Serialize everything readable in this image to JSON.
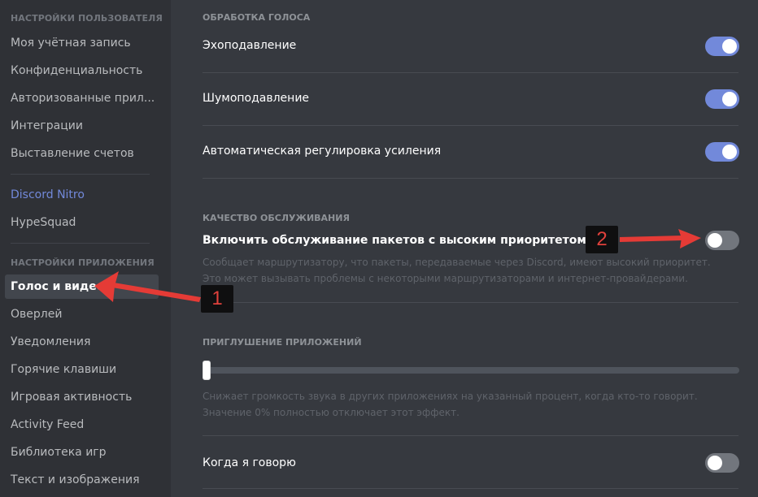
{
  "sidebar": {
    "user_settings_header": "Настройки пользователя",
    "user_items": [
      {
        "label": "Моя учётная запись"
      },
      {
        "label": "Конфиденциальность"
      },
      {
        "label": "Авторизованные прил..."
      },
      {
        "label": "Интеграции"
      },
      {
        "label": "Выставление счетов"
      }
    ],
    "nitro": {
      "label": "Discord Nitro"
    },
    "hypesquad": {
      "label": "HypeSquad"
    },
    "app_settings_header": "Настройки приложения",
    "app_items": [
      {
        "label": "Голос и видео",
        "active": true
      },
      {
        "label": "Оверлей"
      },
      {
        "label": "Уведомления"
      },
      {
        "label": "Горячие клавиши"
      },
      {
        "label": "Игровая активность"
      },
      {
        "label": "Activity Feed"
      },
      {
        "label": "Библиотека игр"
      },
      {
        "label": "Текст и изображения"
      }
    ]
  },
  "voice_processing": {
    "header": "Обработка голоса",
    "rows": [
      {
        "label": "Эхоподавление",
        "enabled": true
      },
      {
        "label": "Шумоподавление",
        "enabled": true
      },
      {
        "label": "Автоматическая регулировка усиления",
        "enabled": true
      }
    ]
  },
  "qos": {
    "header": "Качество обслуживания",
    "label": "Включить обслуживание пакетов с высоким приоритетом",
    "enabled": false,
    "description": "Сообщает маршрутизатору, что пакеты, передаваемые через Discord, имеют высокий приоритет. Это может вызывать проблемы с некоторыми маршрутизаторами и интернет-провайдерами."
  },
  "attenuation": {
    "header": "Приглушение приложений",
    "value_percent": 0,
    "description": "Снижает громкость звука в других приложениях на указанный процент, когда кто-то говорит. Значение 0% полностью отключает этот эффект."
  },
  "when_speaking": {
    "label": "Когда я говорю",
    "enabled": false
  },
  "annotations": {
    "badge_1": "1",
    "badge_2": "2",
    "arrow_color": "#e53b36"
  },
  "colors": {
    "accent": "#7289da",
    "sidebar_bg": "#2f3136",
    "main_bg": "#36393f"
  }
}
